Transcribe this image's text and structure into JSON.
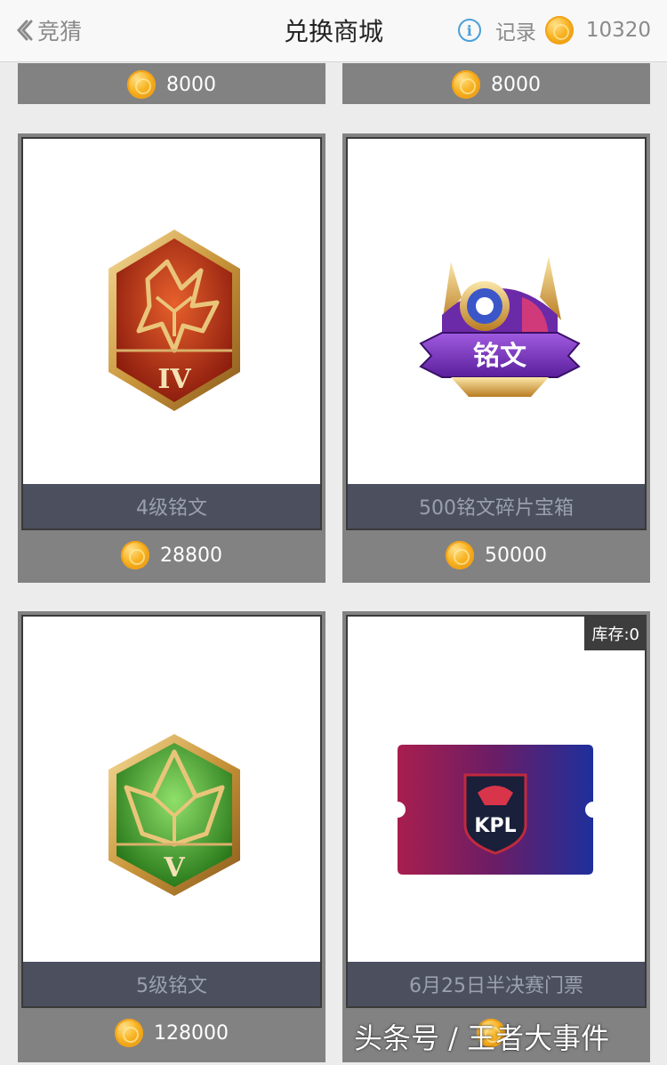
{
  "header": {
    "back_label": "竞猜",
    "title": "兑换商城",
    "records_label": "记录",
    "balance": "10320"
  },
  "top_row": [
    {
      "price": "8000"
    },
    {
      "price": "8000"
    }
  ],
  "items": [
    {
      "name": "4级铭文",
      "price": "28800",
      "emblem_label": "IV"
    },
    {
      "name": "500铭文碎片宝箱",
      "price": "50000",
      "banner_text": "铭文"
    },
    {
      "name": "5级铭文",
      "price": "128000",
      "emblem_label": "V"
    },
    {
      "name": "6月25日半决赛门票",
      "price": "",
      "stock": "库存:0",
      "ticket_text": "KPL"
    }
  ],
  "watermark": "头条号 / 王者大事件",
  "colors": {
    "coin": "#f8b424",
    "card_bg": "#828282",
    "label_bg": "#4b4f5e",
    "info": "#4aa0d8"
  }
}
